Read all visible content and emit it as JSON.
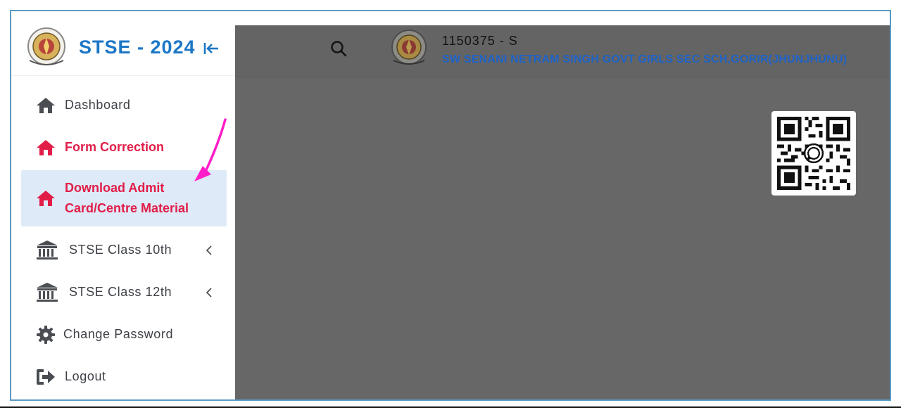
{
  "brand": {
    "title": "STSE - 2024"
  },
  "sidebar": {
    "items": [
      {
        "label": "Dashboard",
        "icon": "home-icon"
      },
      {
        "label": "Form Correction",
        "icon": "home-icon"
      },
      {
        "label_line1": "Download Admit",
        "label_line2": "Card/Centre Material",
        "icon": "home-icon"
      },
      {
        "label": "STSE Class 10th",
        "icon": "institution-icon"
      },
      {
        "label": "STSE Class 12th",
        "icon": "institution-icon"
      },
      {
        "label": "Change Password",
        "icon": "gear-icon"
      },
      {
        "label": "Logout",
        "icon": "logout-icon"
      }
    ]
  },
  "header": {
    "user_id": "1150375 - S",
    "school_name": "SW SENANI NETRAM SINGH GOVT GIRLS SEC SCH,GORIR(JHUNJHUNU)"
  },
  "colors": {
    "brand_blue": "#1b76c6",
    "accent_red": "#e11d48",
    "active_bg": "#deeaf8",
    "overlay_gray": "#676767",
    "annotation_magenta": "#ff1fc8"
  }
}
